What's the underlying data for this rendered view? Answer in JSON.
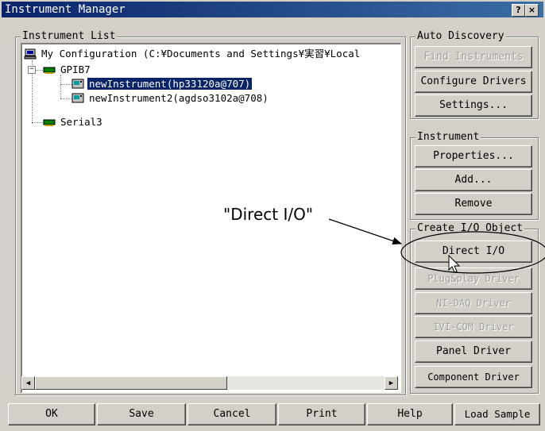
{
  "window": {
    "title": "Instrument Manager",
    "help_btn": "?",
    "close_btn": "×"
  },
  "instrument_list": {
    "legend": "Instrument List",
    "tree": {
      "root": "My Configuration (C:¥Documents and Settings¥実習¥Local",
      "gpib": "GPIB7",
      "instr1": "newInstrument(hp33120a@707)",
      "instr2": "newInstrument2(agdso3102a@708)",
      "serial": "Serial3"
    }
  },
  "auto_discovery": {
    "legend": "Auto Discovery",
    "find_instruments": "Find Instruments",
    "configure_drivers": "Configure Drivers",
    "settings": "Settings..."
  },
  "instrument": {
    "legend": "Instrument",
    "properties": "Properties...",
    "add": "Add...",
    "remove": "Remove"
  },
  "create_io": {
    "legend": "Create I/O Object",
    "direct_io": "Direct I/O",
    "plugplay": "Plug&play Driver",
    "nidaq": "NI-DAQ Driver",
    "ivicom": "IVI-COM Driver",
    "panel": "Panel Driver",
    "component": "Component Driver"
  },
  "bottom": {
    "ok": "OK",
    "save": "Save",
    "cancel": "Cancel",
    "print": "Print",
    "help": "Help",
    "load_sample": "Load Sample"
  },
  "annotation": {
    "label": "\"Direct I/O\""
  }
}
